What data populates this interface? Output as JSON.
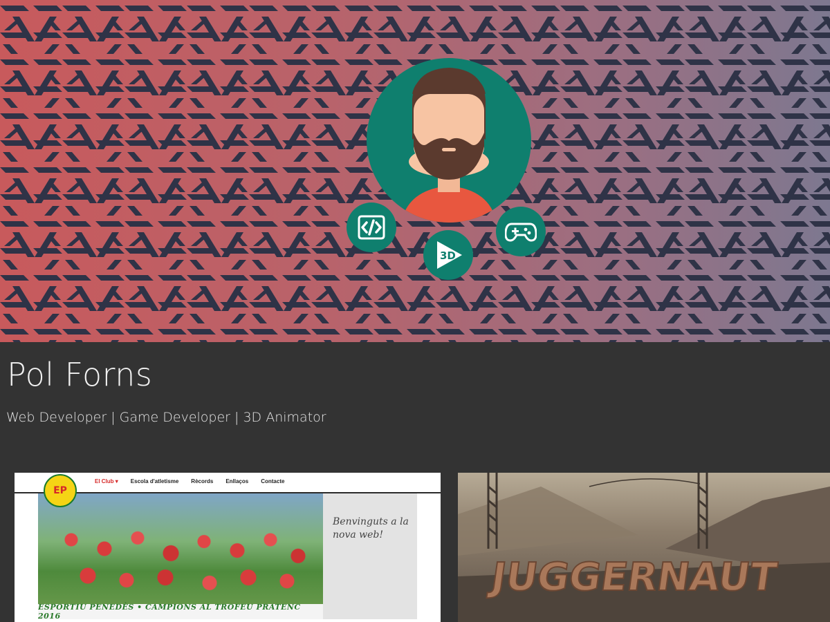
{
  "profile": {
    "name": "Pol Forns",
    "subtitle": "Web Developer | Game Developer | 3D Animator"
  },
  "colors": {
    "accent": "#0f7f6e",
    "background": "#333333",
    "hero_left": "#c85a5c",
    "hero_right": "#7d7890",
    "pattern": "#2f3347"
  },
  "skills": [
    {
      "icon": "code-icon"
    },
    {
      "icon": "3d-icon",
      "label": "3D"
    },
    {
      "icon": "gamepad-icon"
    }
  ],
  "projects": [
    {
      "name": "athletics-club-website",
      "logo_text": "EP",
      "menu": [
        "El Club ▾",
        "Escola d'atletisme",
        "Rècords",
        "Enllaços",
        "Contacte"
      ],
      "caption": "ESPORTIU PENEDÈS  •  CAMPIONS AL TROFEU PRATENC 2016",
      "welcome": "Benvinguts a la nova web!"
    },
    {
      "name": "juggernaut-game",
      "title_art": "JUGGERNAUT"
    }
  ]
}
